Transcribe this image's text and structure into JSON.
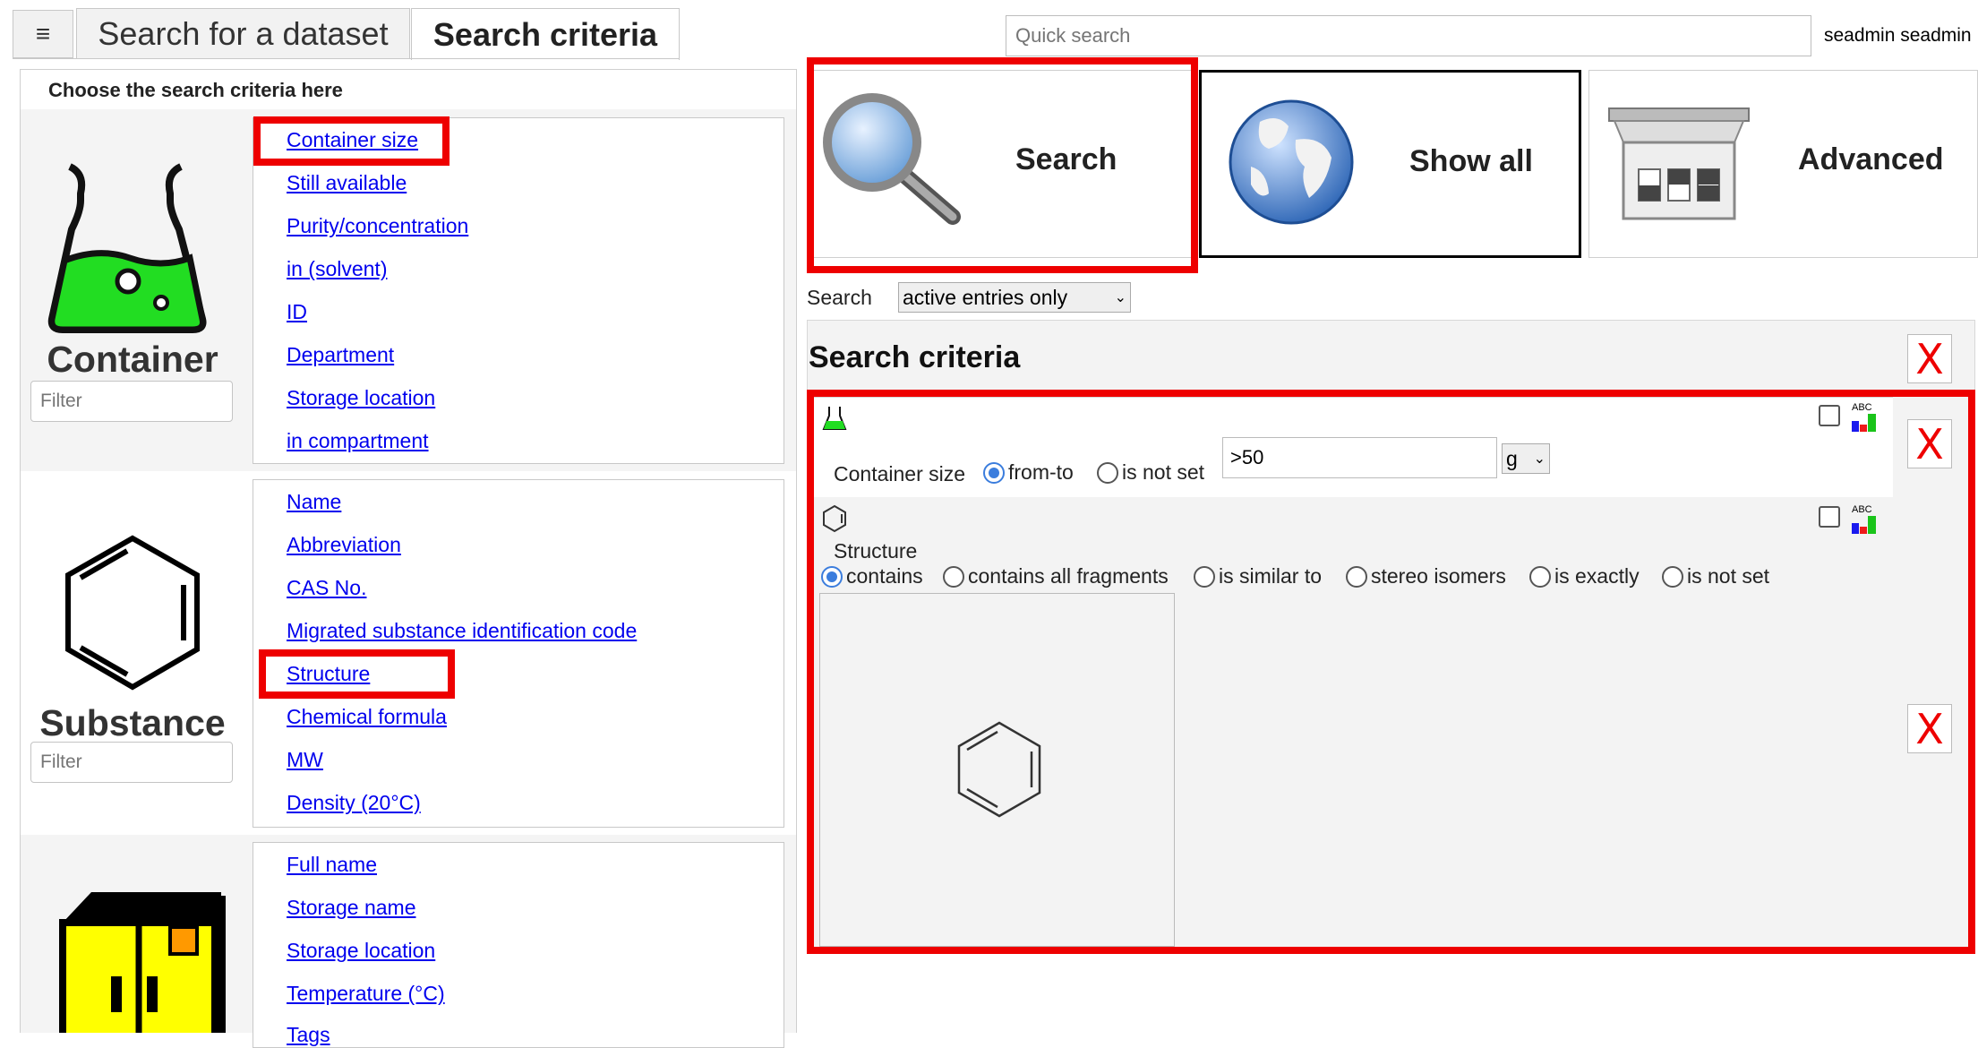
{
  "tabs": {
    "menu_glyph": "≡",
    "tab1": "Search for a dataset",
    "tab2": "Search criteria"
  },
  "header": {
    "quick_search_placeholder": "Quick search",
    "user": "seadmin seadmin"
  },
  "left": {
    "heading": "Choose the search criteria here",
    "filter_placeholder": "Filter",
    "container": {
      "title": "Container",
      "links": [
        "Container size",
        "Still available",
        "Purity/concentration",
        "in (solvent)",
        "ID",
        "Department",
        "Storage location",
        "in compartment"
      ]
    },
    "substance": {
      "title": "Substance",
      "links": [
        "Name",
        "Abbreviation",
        "CAS No.",
        "Migrated substance identification code",
        "Structure",
        "Chemical formula",
        "MW",
        "Density (20°C)"
      ]
    },
    "storage": {
      "links": [
        "Full name",
        "Storage name",
        "Storage location",
        "Temperature (°C)",
        "Tags"
      ]
    }
  },
  "buttons": {
    "search": "Search",
    "show_all": "Show all",
    "advanced": "Advanced"
  },
  "search_filter": {
    "label": "Search",
    "value": "active entries only"
  },
  "criteria": {
    "title": "Search criteria",
    "container_size": {
      "label": "Container size",
      "opt_from_to": "from-to",
      "opt_not_set": "is not set",
      "value": ">50",
      "unit": "g"
    },
    "structure": {
      "label": "Structure",
      "options": [
        "contains",
        "contains all fragments",
        "is similar to",
        "stereo isomers",
        "is exactly",
        "is not set"
      ],
      "selected": "contains"
    },
    "x_glyph": "X",
    "abc": "ABC"
  },
  "colors": {
    "highlight": "#ee0000",
    "link": "#0000ee",
    "flask_green": "#22dd22",
    "storage_yellow": "#ffff00"
  }
}
